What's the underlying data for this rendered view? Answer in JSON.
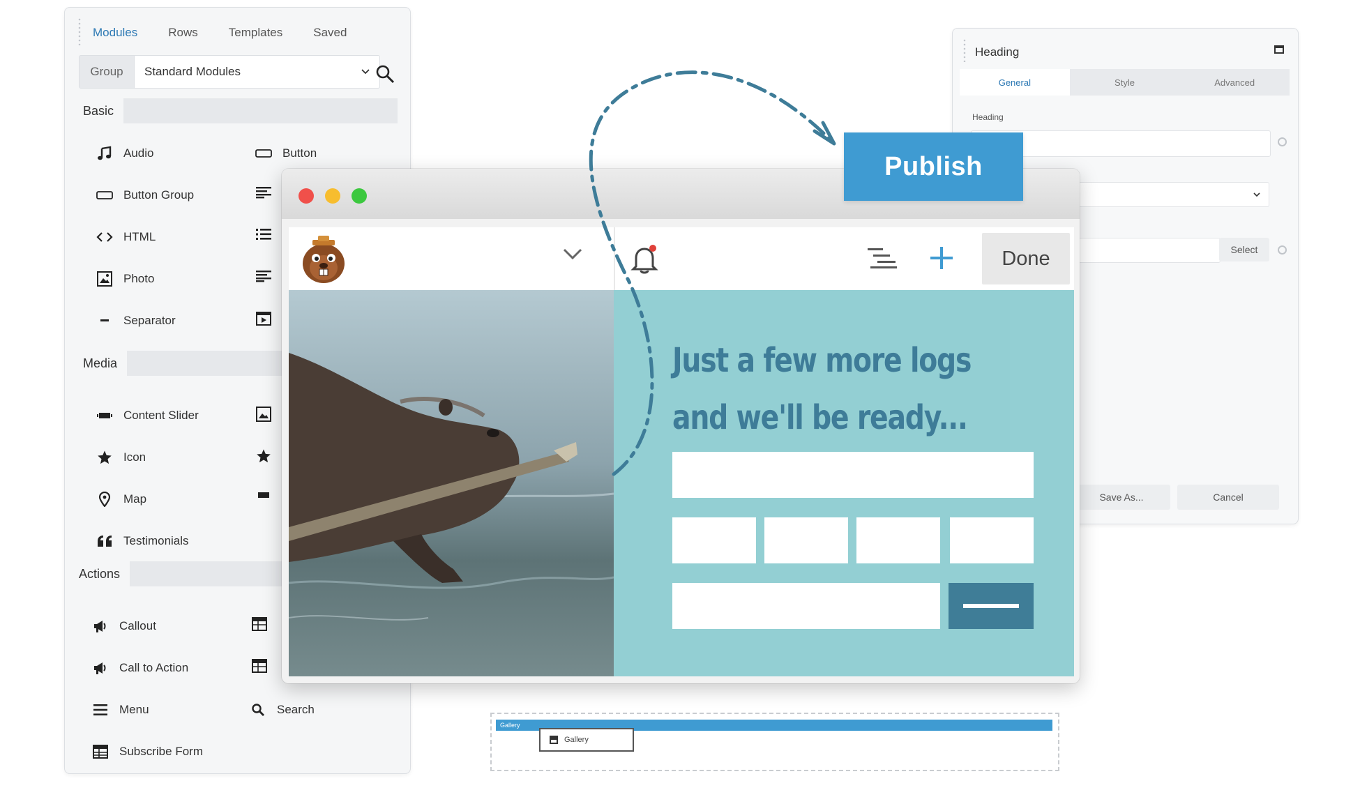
{
  "left_panel": {
    "tabs": [
      "Modules",
      "Rows",
      "Templates",
      "Saved"
    ],
    "group_label": "Group",
    "group_value": "Standard Modules",
    "sections": {
      "basic": "Basic",
      "media": "Media",
      "actions": "Actions"
    },
    "modules": {
      "audio": "Audio",
      "button": "Button",
      "button_group": "Button Group",
      "html": "HTML",
      "photo": "Photo",
      "separator": "Separator",
      "content_slider": "Content Slider",
      "icon": "Icon",
      "map": "Map",
      "testimonials": "Testimonials",
      "callout": "Callout",
      "call_to_action": "Call to Action",
      "menu": "Menu",
      "search": "Search",
      "subscribe_form": "Subscribe Form"
    }
  },
  "right_panel": {
    "title": "Heading",
    "tabs": [
      "General",
      "Style",
      "Advanced"
    ],
    "heading_label": "Heading",
    "select_label": "Select",
    "save_as_label": "Save As...",
    "cancel_label": "Cancel"
  },
  "publish_label": "Publish",
  "browser": {
    "done_label": "Done",
    "headline_line1": "Just a few more logs",
    "headline_line2": "and we'll be ready..."
  },
  "gallery": {
    "bar_label": "Gallery",
    "item_label": "Gallery"
  },
  "colors": {
    "accent": "#3f9bd2",
    "teal_panel": "#93cfd3",
    "headline": "#3e7c98",
    "notification_dot": "#e0413a"
  }
}
